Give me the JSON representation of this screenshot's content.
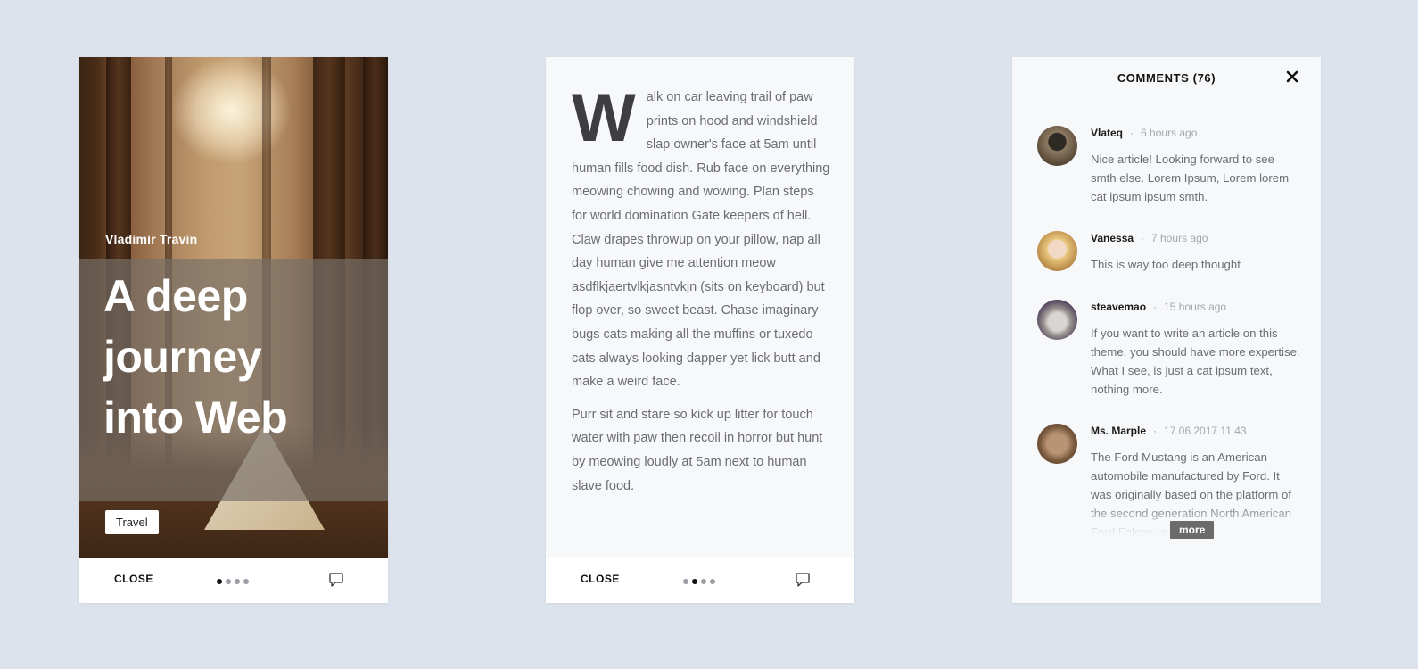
{
  "colors": {
    "background": "#dce3ed",
    "card": "#f7f8fa",
    "text": "#6c6d70",
    "dark": "#111111"
  },
  "card1": {
    "author": "Vladimir Travin",
    "title": "A deep journey into Web",
    "tag": "Travel",
    "footer": {
      "close_label": "CLOSE",
      "page_count": 4,
      "active_page": 1,
      "comments_icon": "speech-bubble-icon"
    }
  },
  "card2": {
    "dropcap": "W",
    "paragraph1": "alk on car leaving trail of paw prints on hood and windshield slap owner's face at 5am until human fills food dish. Rub face on everything meowing chowing and wowing. Plan steps for world domination Gate keepers of hell. Claw drapes throwup on your pillow, nap all day human give me attention meow asdflkjaertvlkjasntvkjn (sits on keyboard) but flop over, so sweet beast. Chase imaginary bugs cats making all the muffins or tuxedo cats always looking dapper yet lick butt and make a weird face.",
    "paragraph2": "Purr sit and stare so kick up litter for touch water with paw then recoil in horror but hunt by meowing loudly at 5am next to human slave food.",
    "footer": {
      "close_label": "CLOSE",
      "page_count": 4,
      "active_page": 2,
      "comments_icon": "speech-bubble-icon"
    }
  },
  "card3": {
    "title": "COMMENTS (76)",
    "close_icon": "close-x-icon",
    "more_label": "more",
    "comments": [
      {
        "user": "Vlateq",
        "sep": "·",
        "time": "6 hours ago",
        "text": "Nice article! Looking forward to see smth else. Lorem Ipsum, Lorem lorem cat ipsum ipsum smth."
      },
      {
        "user": "Vanessa",
        "sep": "·",
        "time": "7 hours ago",
        "text": "This is way too deep thought"
      },
      {
        "user": "steavemao",
        "sep": "·",
        "time": "15 hours ago",
        "text": "If you want to write an article on this theme, you should have more expertise. What I see, is just a cat ipsum text, nothing more."
      },
      {
        "user": "Ms. Marple",
        "sep": "·",
        "time": "17.06.2017 11:43",
        "text": "The Ford Mustang is an American automobile manufactured by Ford. It was originally based on the platform of the second generation North American Ford Falcon, a"
      }
    ]
  }
}
